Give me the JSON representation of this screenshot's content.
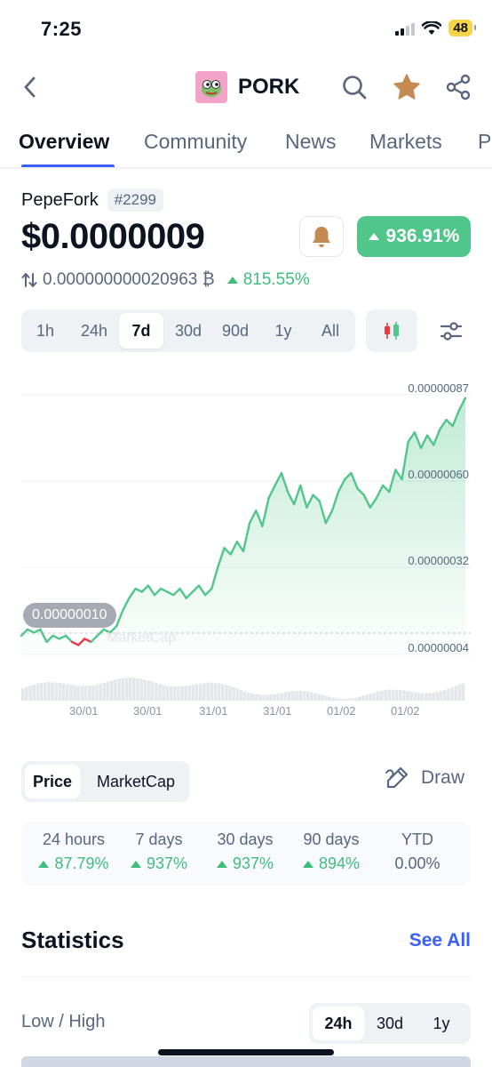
{
  "status": {
    "time": "7:25",
    "battery": "48"
  },
  "nav": {
    "symbol": "PORK"
  },
  "tabs": [
    "Overview",
    "Community",
    "News",
    "Markets",
    "P"
  ],
  "coin": {
    "name": "PepeFork",
    "rank": "#2299",
    "price": "$0.0000009",
    "change_7d": "936.91%",
    "btc_price": "0.000000000020963 ₿",
    "btc_change": "815.55%"
  },
  "ranges": [
    "1h",
    "24h",
    "7d",
    "30d",
    "90d",
    "1y",
    "All"
  ],
  "active_range": "7d",
  "chart_data": {
    "type": "area",
    "y_ticks": [
      "0.00000087",
      "0.00000060",
      "0.00000032",
      "0.00000004"
    ],
    "x_ticks": [
      "30/01",
      "30/01",
      "31/01",
      "31/01",
      "01/02",
      "01/02"
    ],
    "current_label": "0.00000010",
    "watermark": "MarketCap",
    "ylim": [
      4e-08,
      8.7e-07
    ],
    "series": [
      {
        "values": [
          1e-07,
          1.2e-07,
          1.1e-07,
          1.2e-07,
          8e-08,
          1e-07,
          9e-08,
          1e-07,
          8e-08,
          7e-08,
          9e-08,
          8e-08,
          1e-07,
          1.2e-07,
          1.1e-07,
          1.3e-07,
          1.8e-07,
          2.2e-07,
          2.5e-07,
          2.4e-07,
          2.6e-07,
          2.3e-07,
          2.5e-07,
          2.4e-07,
          2.3e-07,
          2.5e-07,
          2.2e-07,
          2.4e-07,
          2.6e-07,
          2.3e-07,
          2.5e-07,
          3.2e-07,
          3.8e-07,
          3.6e-07,
          4e-07,
          3.7e-07,
          4.6e-07,
          5e-07,
          4.5e-07,
          5.4e-07,
          5.8e-07,
          6.2e-07,
          5.6e-07,
          5.2e-07,
          5.8e-07,
          5.1e-07,
          5.5e-07,
          5.3e-07,
          4.6e-07,
          5e-07,
          5.6e-07,
          6e-07,
          6.2e-07,
          5.7e-07,
          5.5e-07,
          5.1e-07,
          5.4e-07,
          5.8e-07,
          5.6e-07,
          6.3e-07,
          6e-07,
          7.2e-07,
          7.5e-07,
          7e-07,
          7.4e-07,
          7.1e-07,
          7.6e-07,
          7.9e-07,
          7.7e-07,
          8.2e-07,
          8.6e-07
        ]
      }
    ],
    "line_color": "#51c68a",
    "down_color": "#ea3943",
    "grid": true
  },
  "chart_toggle": {
    "price": "Price",
    "marketcap": "MarketCap"
  },
  "draw_label": "Draw",
  "performance": [
    {
      "label": "24 hours",
      "value": "87.79%",
      "up": true
    },
    {
      "label": "7 days",
      "value": "937%",
      "up": true
    },
    {
      "label": "30 days",
      "value": "937%",
      "up": true
    },
    {
      "label": "90 days",
      "value": "894%",
      "up": true
    },
    {
      "label": "YTD",
      "value": "0.00%",
      "up": false
    }
  ],
  "statistics": {
    "title": "Statistics",
    "see_all": "See All",
    "low_high": "Low / High",
    "ranges": [
      "24h",
      "30d",
      "1y"
    ]
  },
  "colors": {
    "accent": "#3861fb",
    "up": "#51c68a",
    "down": "#ea3943"
  }
}
